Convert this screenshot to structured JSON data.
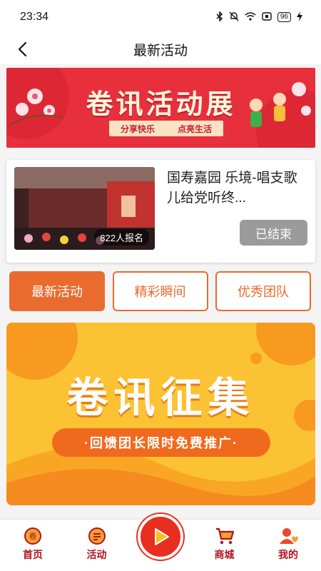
{
  "status": {
    "time": "23:34",
    "battery": "96"
  },
  "nav": {
    "title": "最新活动"
  },
  "banner": {
    "title": "卷讯活动展",
    "sub_left": "分享快乐",
    "sub_right": "点亮生活"
  },
  "activity": {
    "title": "国寿嘉园 乐境-唱支歌儿给党听终...",
    "signup": "822人报名",
    "status": "已结束"
  },
  "tabs": [
    {
      "label": "最新活动",
      "active": true
    },
    {
      "label": "精彩瞬间",
      "active": false
    },
    {
      "label": "优秀团队",
      "active": false
    }
  ],
  "promo": {
    "title": "卷讯征集",
    "subtitle": "·回馈团长限时免费推广·"
  },
  "bottom_nav": [
    {
      "label": "首页",
      "icon": "home-icon"
    },
    {
      "label": "活动",
      "icon": "activity-icon"
    },
    {
      "label": "商城",
      "icon": "cart-icon"
    },
    {
      "label": "我的",
      "icon": "profile-icon"
    }
  ],
  "colors": {
    "accent": "#ea6b2e",
    "brand_red": "#e8303d",
    "nav_label": "#b3121f",
    "ended_gray": "#9b9b9b"
  }
}
